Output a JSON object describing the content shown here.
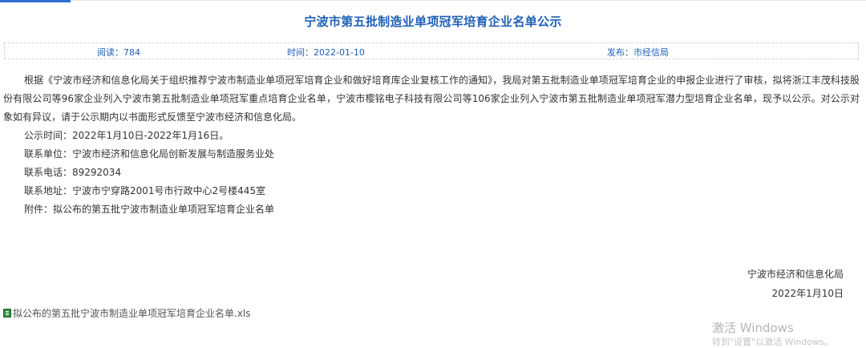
{
  "article": {
    "title": "宁波市第五批制造业单项冠军培育企业名单公示",
    "meta": {
      "reads": "阅读：784",
      "time": "时间：2022-01-10",
      "publisher": "发布：市经信局"
    },
    "body": "根据《宁波市经济和信息化局关于组织推荐宁波市制造业单项冠军培育企业和做好培育库企业复核工作的通知》，我局对第五批制造业单项冠军培育企业的申报企业进行了审核，拟将浙江丰茂科技股份有限公司等96家企业列入宁波市第五批制造业单项冠军重点培育企业名单，宁波市樱铭电子科技有限公司等106家企业列入宁波市第五批制造业单项冠军潜力型培育企业名单，现予以公示。对公示对象如有异议，请于公示期内以书面形式反馈至宁波市经济和信息化局。",
    "lines": {
      "period": "公示时间：2022年1月10日-2022年1月16日。",
      "contact_unit": "联系单位：宁波市经济和信息化局创新发展与制造服务业处",
      "phone": "联系电话：89292034",
      "address": "联系地址：宁波市宁穿路2001号市行政中心2号楼445室",
      "attachment": "附件：拟公布的第五批宁波市制造业单项冠军培育企业名单"
    },
    "signature": {
      "org": "宁波市经济和信息化局",
      "date": "2022年1月10日"
    },
    "attachment_link": {
      "icon": "xls-file-icon",
      "label": "拟公布的第五批宁波市制造业单项冠军培育企业名单.xls"
    }
  },
  "watermark": {
    "line1": "激活 Windows",
    "line2": "转到\"设置\"以激活 Windows。"
  },
  "colors": {
    "accent": "#1f5fb8",
    "tab_accent": "#2d6fd1",
    "text": "#333333",
    "meta_border": "#c9d2de"
  }
}
